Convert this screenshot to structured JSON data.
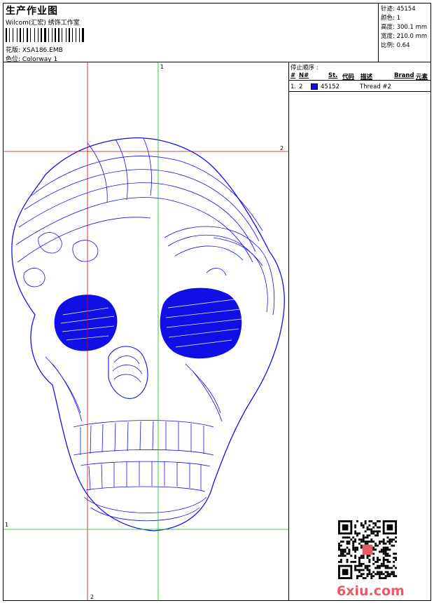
{
  "header": {
    "title": "生产作业图",
    "company": "Wilcom(汇宏) 绣饰工作室",
    "design_label": "花版: XSA186.EMB",
    "colorway_label": "色位: Colorway 1"
  },
  "specs": {
    "stitches": "针迹: 45154",
    "colors": "颜色: 1",
    "height": "高度: 300.1 mm",
    "width": "宽度: 210.0 mm",
    "scale": "比例: 0.64"
  },
  "threads": {
    "stop_sequence_label": "停止顺序 :",
    "columns": [
      "#",
      "N#",
      "St.",
      "代码",
      "描述",
      "Brand",
      "元素"
    ],
    "rows": [
      {
        "index": "1.",
        "needle": "2",
        "stitches": "45152",
        "description": "Thread #2",
        "swatch": "#1010e0"
      }
    ]
  },
  "guides": {
    "green_top": "1",
    "green_bottom": "1",
    "red_right": "2",
    "red_bottom": "2"
  },
  "colors": {
    "embroidery": "#1010e6",
    "guide_red": "#d40000",
    "guide_green": "#00c000",
    "watermark": "#e85a66"
  },
  "watermark": "6xiu.com"
}
